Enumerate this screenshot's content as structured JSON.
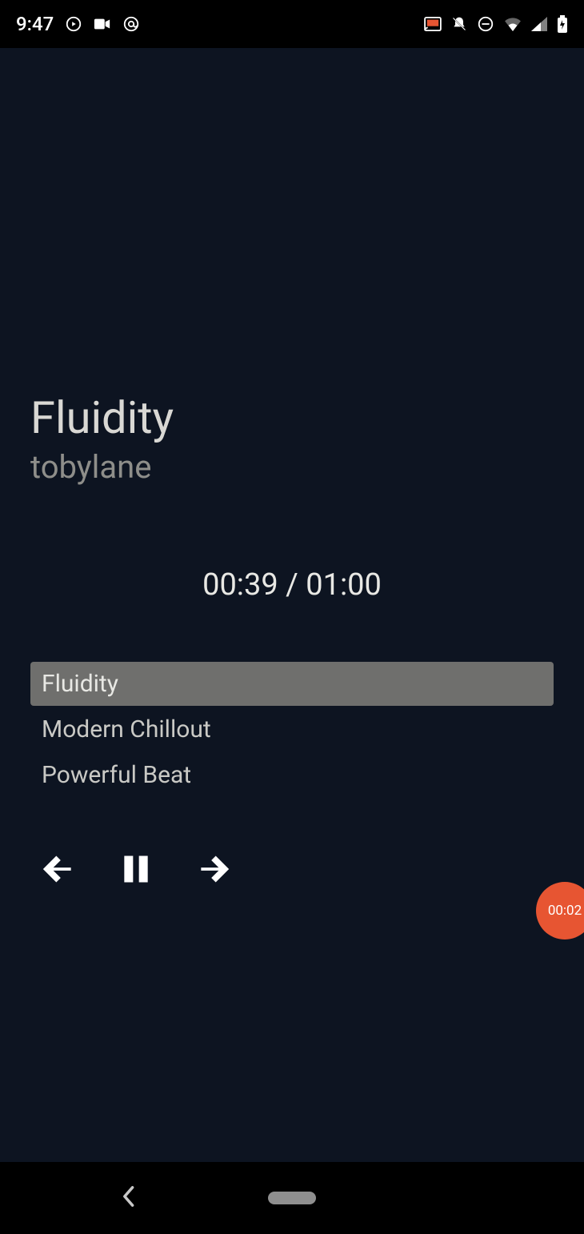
{
  "status": {
    "time": "9:47",
    "icons_left": [
      "play-circle-icon",
      "videocam-icon",
      "at-icon"
    ],
    "icons_right": [
      "cast-icon",
      "bell-off-icon",
      "dnd-icon",
      "wifi-icon",
      "signal-icon",
      "battery-icon"
    ]
  },
  "player": {
    "title": "Fluidity",
    "artist": "tobylane",
    "elapsed": "00:39",
    "separator": " / ",
    "duration": "01:00"
  },
  "playlist": [
    {
      "label": "Fluidity",
      "active": true
    },
    {
      "label": "Modern Chillout",
      "active": false
    },
    {
      "label": "Powerful Beat",
      "active": false
    }
  ],
  "controls": {
    "prev": "previous",
    "pause": "pause",
    "next": "next"
  },
  "recorder": {
    "time": "00:02"
  },
  "colors": {
    "bg": "#0d1421",
    "accent": "#e75532"
  }
}
